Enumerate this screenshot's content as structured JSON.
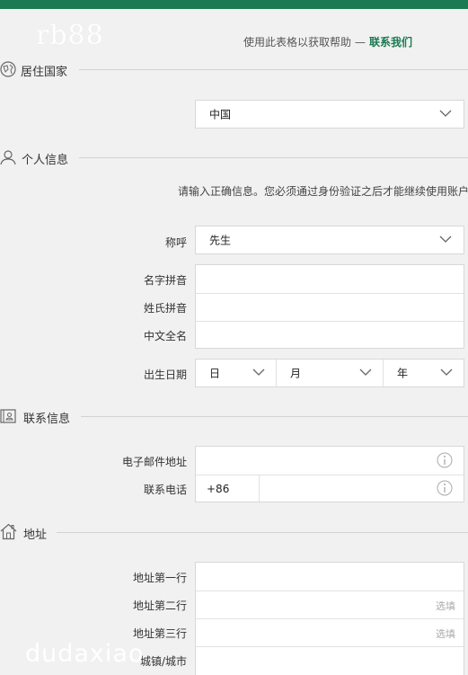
{
  "colors": {
    "brand": "#1a7a52",
    "link": "#1a7a52"
  },
  "watermarks": {
    "top": "rb88",
    "bottom": "dudaxiao"
  },
  "help": {
    "text": "使用此表格以获取帮助",
    "dash": "—",
    "link": "联系我们"
  },
  "sections": {
    "residence": {
      "title": "居住国家",
      "icon": "globe-icon"
    },
    "personal": {
      "title": "个人信息",
      "icon": "person-icon"
    },
    "contact": {
      "title": "联系信息",
      "icon": "contact-card-icon"
    },
    "address": {
      "title": "地址",
      "icon": "house-icon"
    }
  },
  "residence": {
    "country_value": "中国"
  },
  "personal": {
    "notice": "请输入正确信息。您必须通过身份验证之后才能继续使用账户",
    "salutation_label": "称呼",
    "salutation_value": "先生",
    "first_name_label": "名字拼音",
    "last_name_label": "姓氏拼音",
    "chinese_name_label": "中文全名",
    "dob_label": "出生日期",
    "dob_day": "日",
    "dob_month": "月",
    "dob_year": "年"
  },
  "contact": {
    "email_label": "电子邮件地址",
    "phone_label": "联系电话",
    "phone_prefix": "+86"
  },
  "address": {
    "line1_label": "地址第一行",
    "line2_label": "地址第二行",
    "line3_label": "地址第三行",
    "city_label": "城镇/城市",
    "optional_placeholder": "选填"
  }
}
